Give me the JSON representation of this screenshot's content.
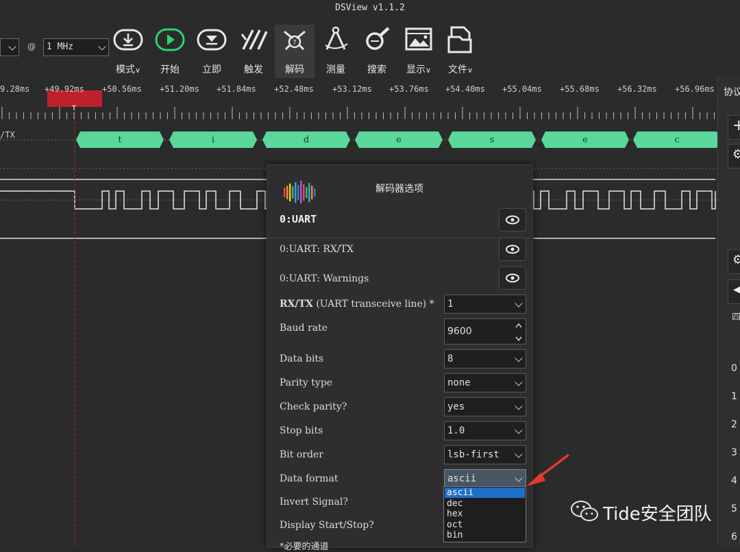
{
  "window": {
    "title": "DSView v1.1.2"
  },
  "toolbar": {
    "sample_count_value": "",
    "at_symbol": "@",
    "sample_rate_value": "1 MHz",
    "buttons": [
      {
        "label": "模式",
        "icon": "download-icon"
      },
      {
        "label": "开始",
        "icon": "play-icon"
      },
      {
        "label": "立即",
        "icon": "single-shot-icon"
      },
      {
        "label": "触发",
        "icon": "trigger-icon"
      },
      {
        "label": "解码",
        "icon": "decode-icon"
      },
      {
        "label": "测量",
        "icon": "measure-icon"
      },
      {
        "label": "搜索",
        "icon": "search-icon"
      },
      {
        "label": "显示",
        "icon": "display-icon"
      },
      {
        "label": "文件",
        "icon": "file-icon"
      }
    ]
  },
  "timeline": {
    "ticks": [
      "9.28ms",
      "+49.92ms",
      "+50.56ms",
      "+51.20ms",
      "+51.84ms",
      "+52.48ms",
      "+53.12ms",
      "+53.76ms",
      "+54.40ms",
      "+55.04ms",
      "+55.68ms",
      "+56.32ms",
      "+56.96ms"
    ],
    "trigger_marker": "T"
  },
  "decoder_row": {
    "label": "/TX",
    "segments": [
      "t",
      "i",
      "d",
      "e",
      "s",
      "e",
      "c"
    ]
  },
  "dialog": {
    "title": "解码器选项",
    "decoder_name": "0:UART",
    "layers": [
      "0:UART: RX/TX",
      "0:UART: Warnings"
    ],
    "channel": {
      "label_bold": "RX/TX",
      "label_rest": "(UART transceive line) *",
      "value": "1"
    },
    "options": [
      {
        "label": "Baud rate",
        "value": "9600"
      },
      {
        "label": "Data bits",
        "value": "8"
      },
      {
        "label": "Parity type",
        "value": "none"
      },
      {
        "label": "Check parity?",
        "value": "yes"
      },
      {
        "label": "Stop bits",
        "value": "1.0"
      },
      {
        "label": "Bit order",
        "value": "lsb-first"
      },
      {
        "label": "Data format",
        "value": "ascii"
      },
      {
        "label": "Invert Signal?",
        "value": ""
      },
      {
        "label": "Display Start/Stop?",
        "value": ""
      }
    ],
    "footnote": "*必要的通道"
  },
  "dropdown": {
    "options": [
      "ascii",
      "dec",
      "hex",
      "oct",
      "bin"
    ],
    "selected": "ascii"
  },
  "right_panel": {
    "title": "协议",
    "partial_text": "四",
    "row_numbers": [
      "0",
      "1",
      "2",
      "3",
      "4",
      "5",
      "6"
    ]
  },
  "watermark": {
    "text": "Tide安全团队"
  },
  "colors": {
    "background": "#2b2b2b",
    "decode_segment": "#5ad79a",
    "trigger_marker": "#c0202c",
    "dropdown_highlight": "#1e6fc8",
    "annotation_arrow": "#e23b2e"
  }
}
